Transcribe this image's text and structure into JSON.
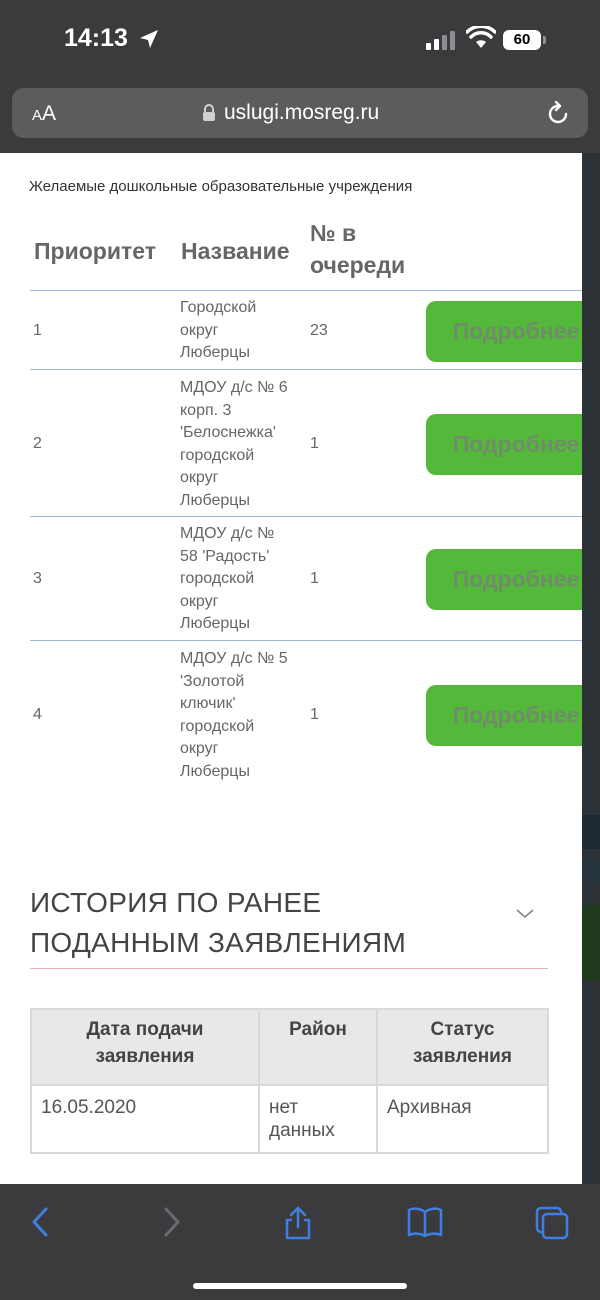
{
  "status_bar": {
    "time": "14:13",
    "battery": "60"
  },
  "browser": {
    "text_size_label_small": "A",
    "text_size_label_large": "A",
    "url": "uslugi.mosreg.ru"
  },
  "section": {
    "label": "Желаемые дошкольные образовательные учреждения",
    "headers": {
      "priority": "Приоритет",
      "name": "Название",
      "queue_line1": "№ в",
      "queue_line2": "очереди"
    },
    "rows": [
      {
        "priority": "1",
        "name": [
          "Городской",
          "округ",
          "Люберцы"
        ],
        "queue": "23",
        "button": "Подробнее"
      },
      {
        "priority": "2",
        "name": [
          "МДОУ д/с № 6",
          "корп. 3",
          "'Белоснежка'",
          "городской",
          "округ",
          "Люберцы"
        ],
        "queue": "1",
        "button": "Подробнее"
      },
      {
        "priority": "3",
        "name": [
          "МДОУ д/с №",
          "58 'Радость'",
          "городской",
          "округ",
          "Люберцы"
        ],
        "queue": "1",
        "button": "Подробнее"
      },
      {
        "priority": "4",
        "name": [
          "МДОУ д/с № 5",
          "'Золотой",
          "ключик'",
          "городской",
          "округ",
          "Люберцы"
        ],
        "queue": "1",
        "button": "Подробнее"
      }
    ]
  },
  "history": {
    "title_line1": "ИСТОРИЯ ПО РАНЕЕ",
    "title_line2": "ПОДАННЫМ ЗАЯВЛЕНИЯМ",
    "columns": [
      [
        "Дата подачи",
        "заявления"
      ],
      [
        "Район"
      ],
      [
        "Статус",
        "заявления"
      ]
    ],
    "rows": [
      {
        "date": "16.05.2020",
        "district": [
          "нет",
          "данных"
        ],
        "status": "Архивная"
      }
    ]
  },
  "colors": {
    "button": "#54b93a",
    "accent_icon": "#3f7fe0",
    "toolbar": "#3b3b3d"
  },
  "icons": [
    "location-arrow-icon",
    "signal-icon",
    "wifi-icon",
    "lock-icon",
    "reload-icon",
    "chevron-down-icon",
    "back-icon",
    "forward-icon",
    "share-icon",
    "bookmarks-icon",
    "tabs-icon"
  ]
}
